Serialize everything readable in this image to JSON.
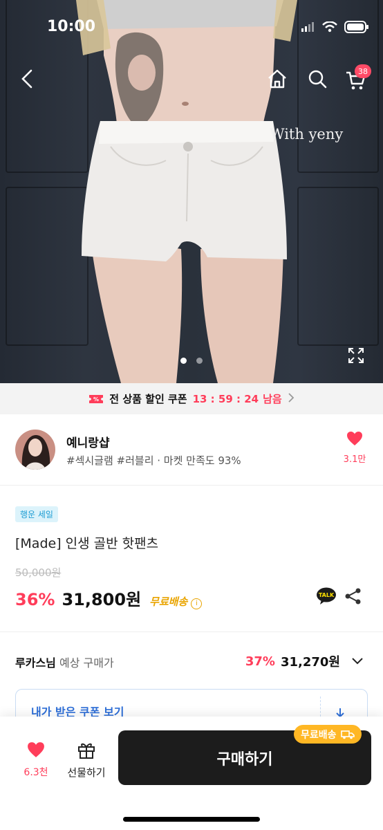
{
  "status_bar": {
    "time": "10:00"
  },
  "hero": {
    "watermark": "With yeny",
    "cart_count": "38",
    "page_count": 2,
    "active_page": 0
  },
  "coupon_banner": {
    "label": "전 상품 할인 쿠폰",
    "timer": "13 : 59 : 24",
    "suffix": "남음"
  },
  "shop": {
    "name": "예니랑샵",
    "tags": "#섹시글램 #러블리 · 마켓 만족도 93%",
    "likes": "3.1만"
  },
  "product": {
    "badge": "행운 세일",
    "title": "[Made] 인생 골반 핫팬츠",
    "original_price": "50,000원",
    "discount": "36%",
    "price": "31,800원",
    "shipping": "무료배송",
    "talk_label": "TALK"
  },
  "estimate": {
    "user": "루카스님",
    "label": "예상 구매가",
    "discount": "37%",
    "price": "31,270원"
  },
  "coupon_box": {
    "label": "내가 받은 쿠폰 보기"
  },
  "bottom_bar": {
    "wish_count": "6.3천",
    "gift_label": "선물하기",
    "buy_label": "구매하기",
    "shipping_tag": "무료배송"
  },
  "colors": {
    "accent": "#ff3d5a",
    "shipping": "#e9a400",
    "coupon_blue": "#2e6fd8",
    "buy_button": "#1c1c1c"
  }
}
